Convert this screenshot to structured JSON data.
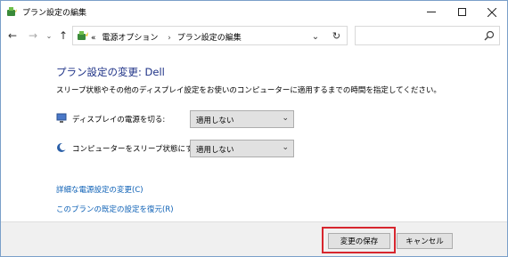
{
  "window": {
    "title": "プラン設定の編集",
    "icons": {
      "app": "power-options-icon"
    }
  },
  "nav": {
    "back_icon": "←",
    "forward_icon": "→",
    "recent_icon": "⌄",
    "up_icon": "↑",
    "breadcrumb_prefix": "«",
    "breadcrumbs": [
      "電源オプション",
      "プラン設定の編集"
    ],
    "breadcrumb_separator": "›",
    "dropdown_icon": "⌄",
    "refresh_icon": "↻",
    "search_placeholder": ""
  },
  "main": {
    "heading": "プラン設定の変更: Dell",
    "description": "スリープ状態やその他のディスプレイ設定をお使いのコンピューターに適用するまでの時間を指定してください。",
    "settings": [
      {
        "label": "ディスプレイの電源を切る:",
        "value": "適用しない",
        "icon": "display-icon"
      },
      {
        "label": "コンピューターをスリープ状態にする:",
        "value": "適用しない",
        "icon": "sleep-moon-icon"
      }
    ],
    "links": [
      "詳細な電源設定の変更(C)",
      "このプランの既定の設定を復元(R)"
    ]
  },
  "buttons": {
    "save": "変更の保存",
    "cancel": "キャンセル"
  },
  "colors": {
    "heading": "#1e3287",
    "link": "#0b5fb5",
    "highlight": "#d7262e"
  }
}
